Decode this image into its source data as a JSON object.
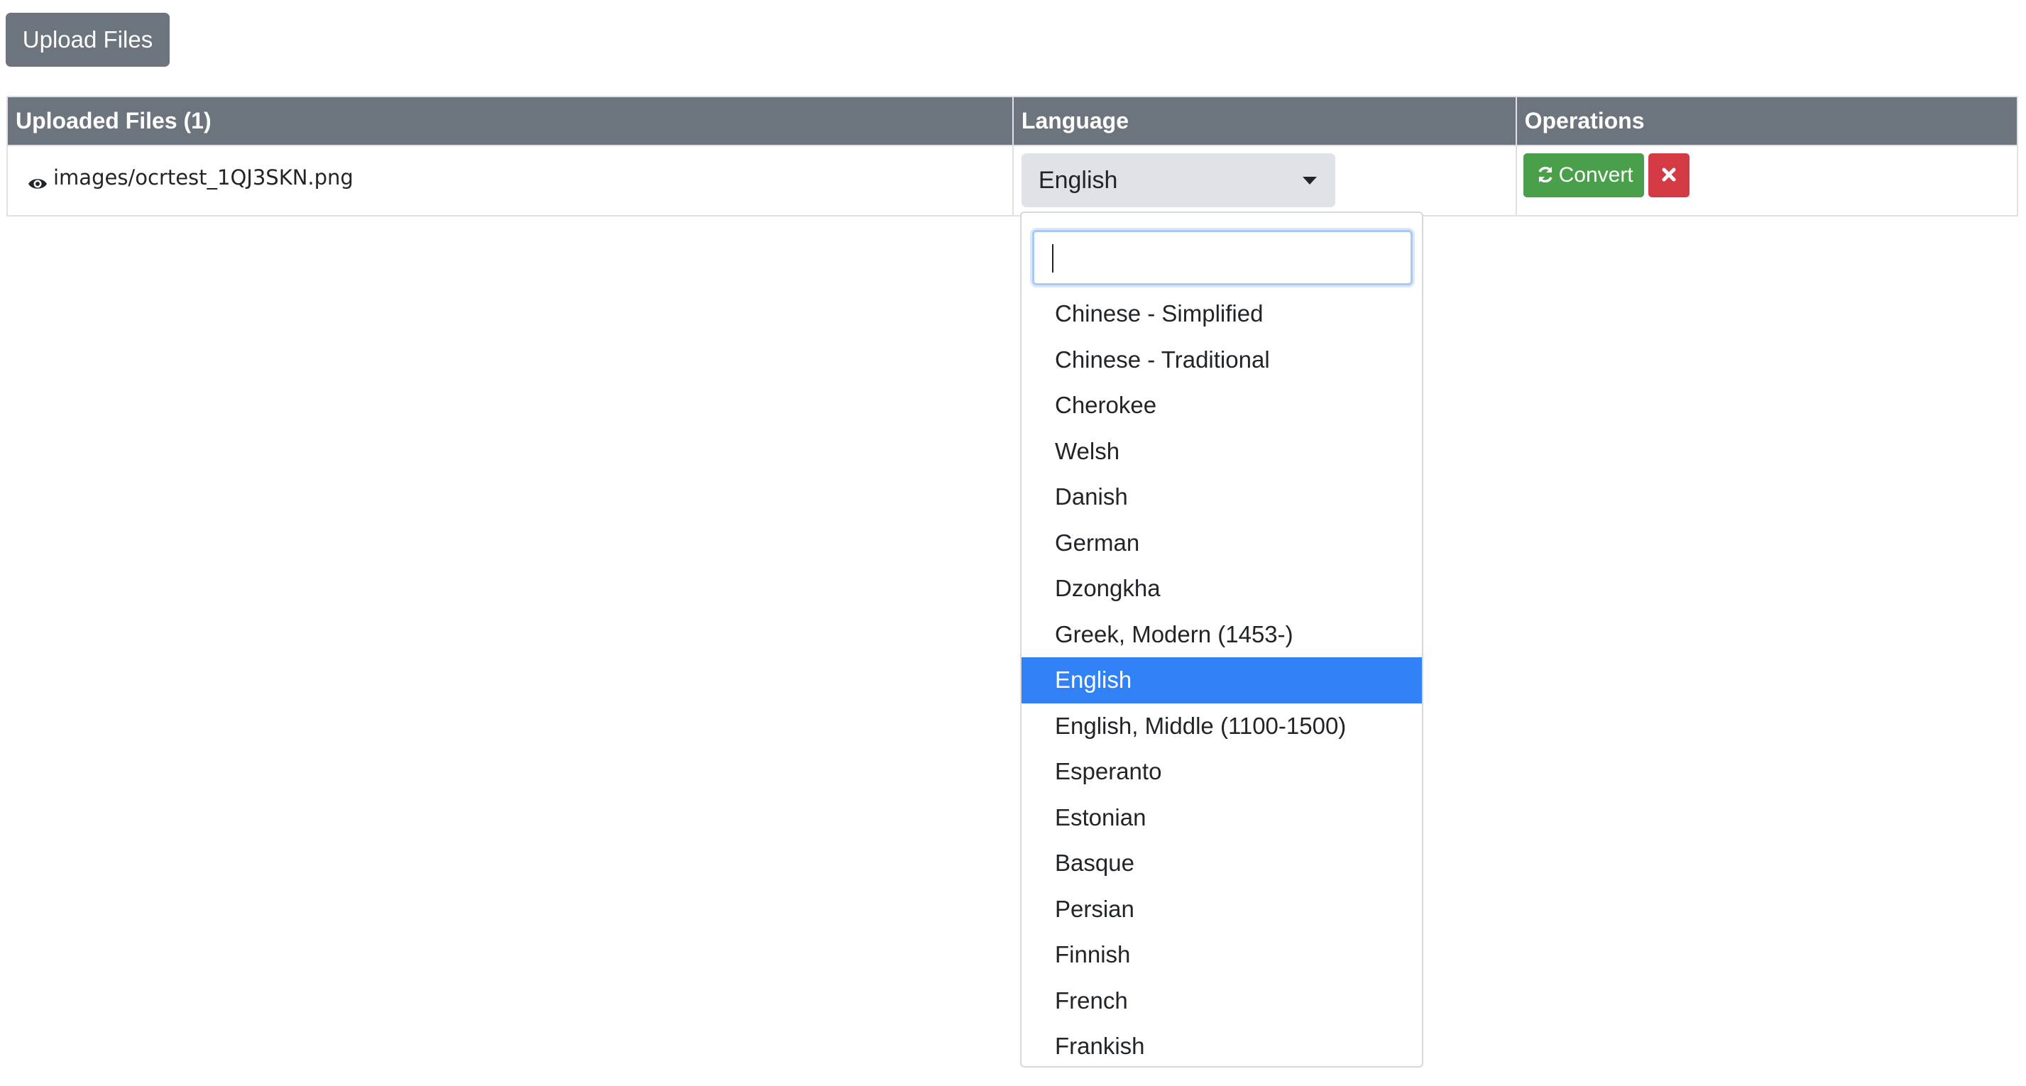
{
  "upload": {
    "label": "Upload Files"
  },
  "table": {
    "headers": {
      "files": "Uploaded Files (1)",
      "language": "Language",
      "operations": "Operations"
    },
    "rows": [
      {
        "file": "images/ocrtest_1QJ3SKN.png",
        "language": "English",
        "convert_label": "Convert"
      }
    ]
  },
  "icons": {
    "preview": "eye-icon",
    "caret": "caret-down-icon",
    "convert": "refresh-icon",
    "delete": "close-icon"
  },
  "colors": {
    "header_bg": "#6c757d",
    "convert": "#4aa04a",
    "delete": "#d33a44",
    "selected_option": "#3182f6"
  },
  "dropdown": {
    "search_value": "",
    "selected": "English",
    "options": [
      "Chinese - Simplified",
      "Chinese - Traditional",
      "Cherokee",
      "Welsh",
      "Danish",
      "German",
      "Dzongkha",
      "Greek, Modern (1453-)",
      "English",
      "English, Middle (1100-1500)",
      "Esperanto",
      "Estonian",
      "Basque",
      "Persian",
      "Finnish",
      "French",
      "Frankish"
    ]
  }
}
